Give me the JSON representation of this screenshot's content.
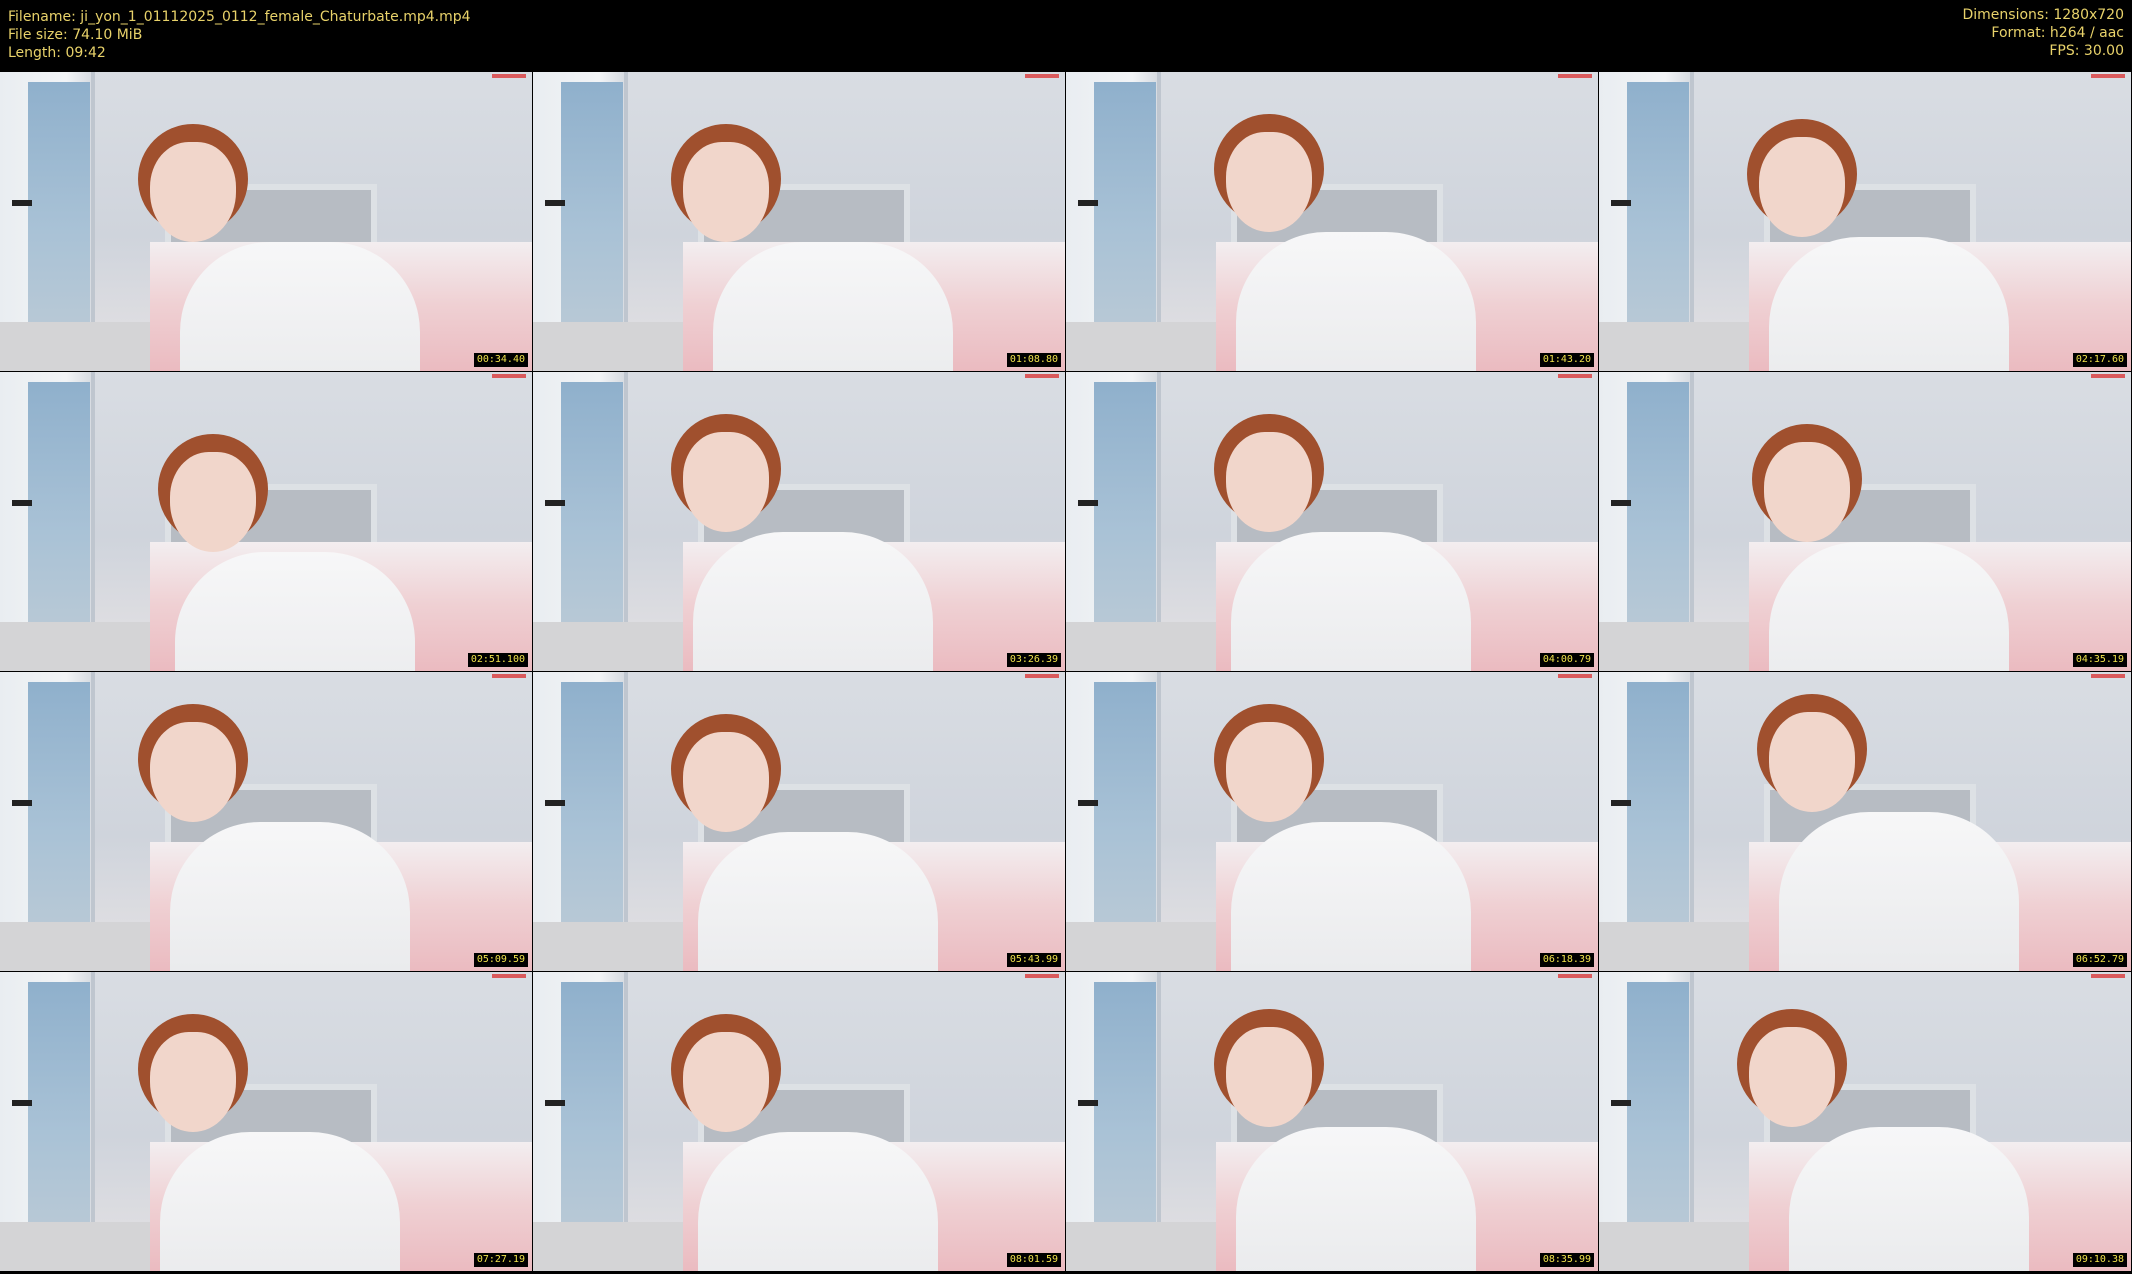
{
  "header": {
    "filename": "Filename: ji_yon_1_01112025_0112_female_Chaturbate.mp4.mp4",
    "filesize": "File size: 74.10 MiB",
    "length": "Length: 09:42",
    "dimensions": "Dimensions: 1280x720",
    "format": "Format: h264 / aac",
    "fps": "FPS: 30.00"
  },
  "colors": {
    "header_text": "#e8d26a",
    "timestamp_text": "#f0e24c",
    "background": "#000000"
  },
  "thumbnails": [
    {
      "time": "00:34.40"
    },
    {
      "time": "01:08.80"
    },
    {
      "time": "01:43.20"
    },
    {
      "time": "02:17.60"
    },
    {
      "time": "02:51.100"
    },
    {
      "time": "03:26.39"
    },
    {
      "time": "04:00.79"
    },
    {
      "time": "04:35.19"
    },
    {
      "time": "05:09.59"
    },
    {
      "time": "05:43.99"
    },
    {
      "time": "06:18.39"
    },
    {
      "time": "06:52.79"
    },
    {
      "time": "07:27.19"
    },
    {
      "time": "08:01.59"
    },
    {
      "time": "08:35.99"
    },
    {
      "time": "09:10.38"
    }
  ]
}
